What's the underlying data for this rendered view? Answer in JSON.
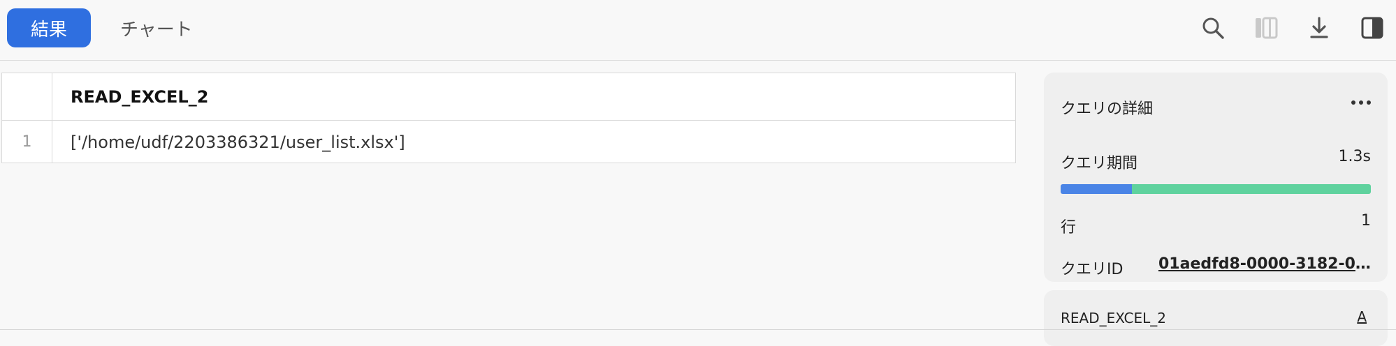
{
  "tabs": {
    "results": "結果",
    "chart": "チャート"
  },
  "toolbar": {
    "icons": [
      "search-icon",
      "columns-icon",
      "download-icon",
      "panel-toggle-icon"
    ]
  },
  "table": {
    "columns": [
      "READ_EXCEL_2"
    ],
    "rows": [
      {
        "num": "1",
        "cells": [
          "['/home/udf/2203386321/user_list.xlsx']"
        ]
      }
    ]
  },
  "query_details": {
    "title": "クエリの詳細",
    "duration_label": "クエリ期間",
    "duration_value": "1.3s",
    "duration_split": {
      "first_fraction": 0.23,
      "first_color": "#4a84e6",
      "second_color": "#5fd29e"
    },
    "rows_label": "行",
    "rows_value": "1",
    "query_id_label": "クエリID",
    "query_id_value": "01aedfd8-0000-3182-0..."
  },
  "column_panel": {
    "column_name": "READ_EXCEL_2",
    "type_link": "A"
  },
  "colors": {
    "accent": "#2f6fe0"
  }
}
